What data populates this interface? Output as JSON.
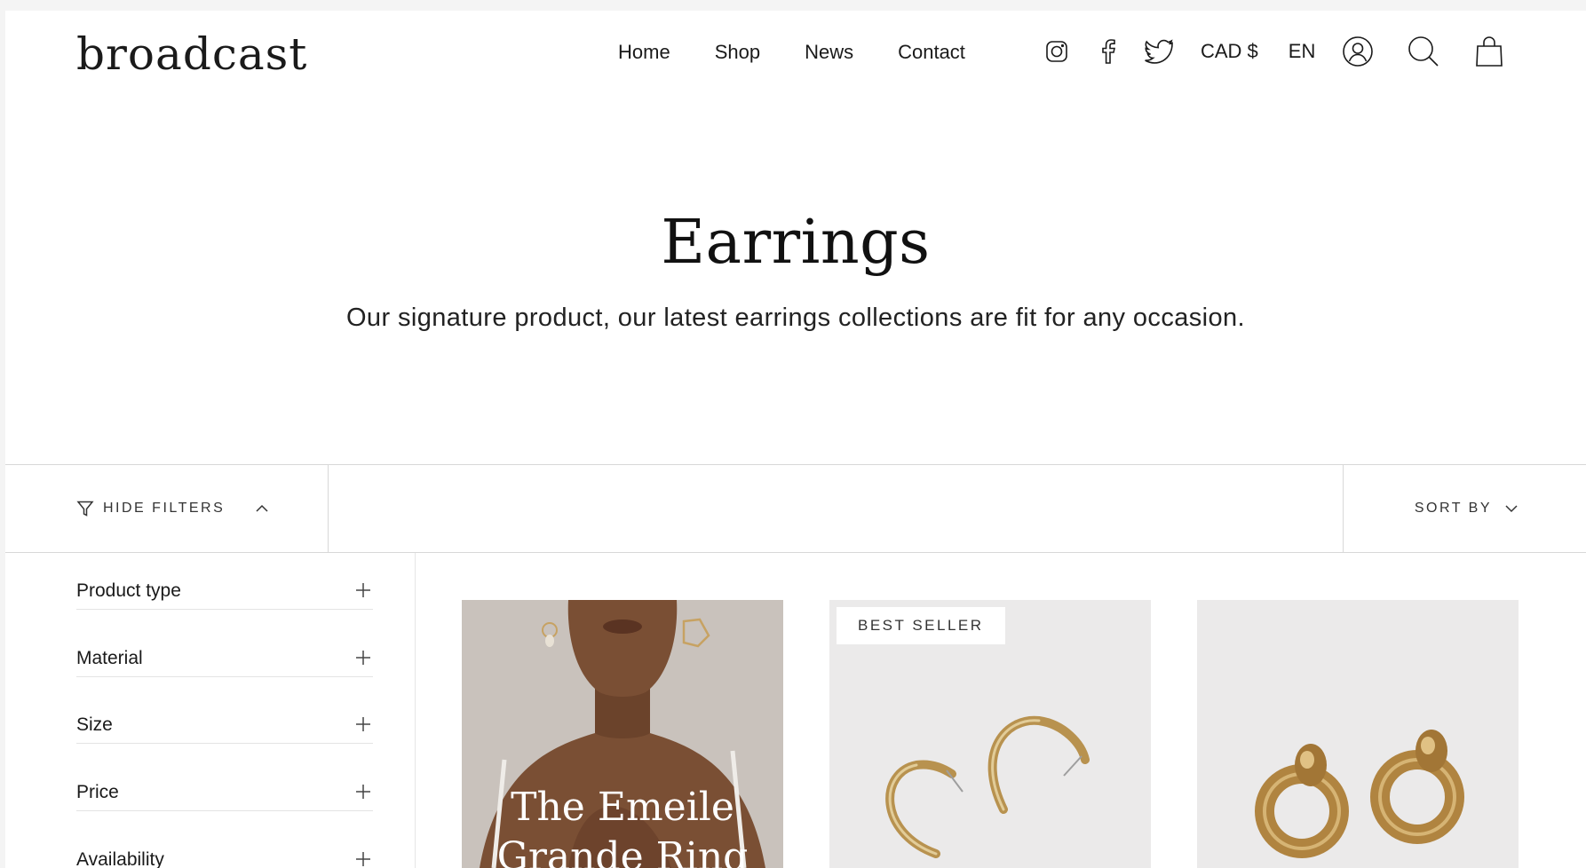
{
  "brand": {
    "logo_text": "broadcast"
  },
  "nav": {
    "items": [
      "Home",
      "Shop",
      "News",
      "Contact"
    ]
  },
  "header_right": {
    "social_icons": [
      "instagram-icon",
      "facebook-icon",
      "twitter-icon"
    ],
    "currency": "CAD $",
    "language": "EN",
    "utility_icons": [
      "account-icon",
      "search-icon",
      "cart-bag-icon"
    ]
  },
  "collection": {
    "title": "Earrings",
    "description": "Our signature product, our latest earrings collections are fit for any occasion."
  },
  "filter_bar": {
    "hide_filters_label": "HIDE FILTERS",
    "sort_by_label": "SORT BY"
  },
  "filters": {
    "facets": [
      "Product type",
      "Material",
      "Size",
      "Price",
      "Availability"
    ]
  },
  "products": [
    {
      "overlay_title_line1": "The Emeile",
      "overlay_title_line2": "Grande Ring"
    },
    {
      "badge": "BEST SELLER"
    },
    {}
  ],
  "colors": {
    "page_bg": "#ffffff",
    "text": "#1a1a1a",
    "divider": "#d8d8d8",
    "card_bg": "#ebeaea",
    "gold": "#b8924f"
  }
}
